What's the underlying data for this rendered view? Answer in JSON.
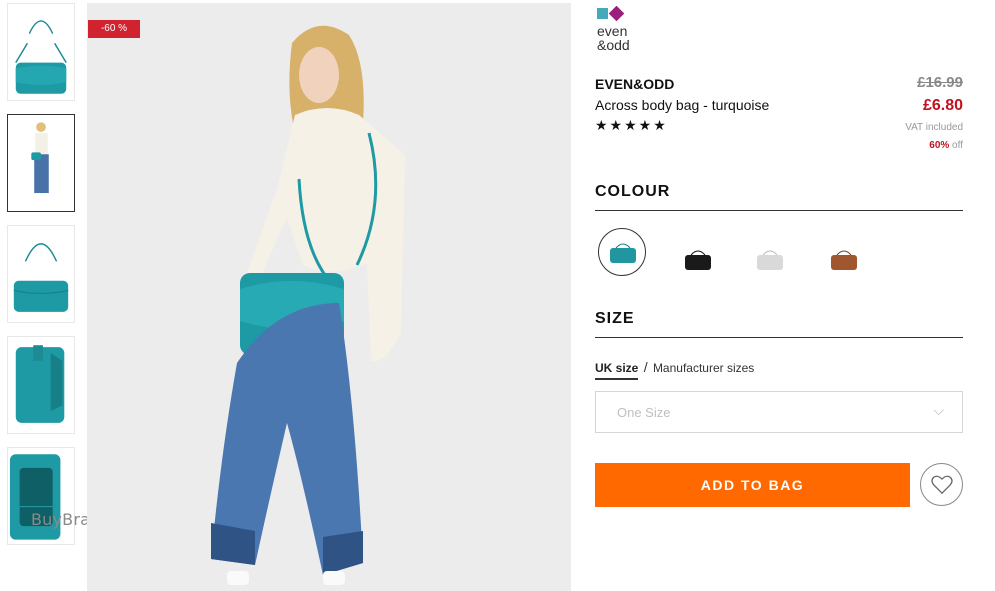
{
  "gallery": {
    "badge": "-60 %",
    "watermark": "BuyBrands",
    "thumbnails": [
      {
        "name": "bag-front"
      },
      {
        "name": "model-full"
      },
      {
        "name": "bag-back"
      },
      {
        "name": "bag-side"
      },
      {
        "name": "bag-inside"
      }
    ]
  },
  "logo": {
    "alt": "even & odd"
  },
  "product": {
    "brand": "EVEN&ODD",
    "title": "Across body bag - turquoise",
    "stars": "★★★★★",
    "old_price": "£16.99",
    "price": "£6.80",
    "vat": "VAT included",
    "discount_pct": "60%",
    "discount_suffix": " off"
  },
  "colour": {
    "heading": "COLOUR",
    "swatches": [
      {
        "name": "turquoise",
        "color": "#2296a0",
        "selected": true
      },
      {
        "name": "black",
        "color": "#1a1a1a",
        "selected": false
      },
      {
        "name": "light-grey",
        "color": "#d9d9d9",
        "selected": false
      },
      {
        "name": "brown",
        "color": "#a0572f",
        "selected": false
      }
    ]
  },
  "size": {
    "heading": "SIZE",
    "tab_uk": "UK size",
    "slash": "/",
    "tab_manufacturer": "Manufacturer sizes",
    "selected_value": "One Size"
  },
  "actions": {
    "add_to_bag": "ADD TO BAG"
  },
  "colors": {
    "accent_orange": "#ff6900",
    "price_red": "#c1121f",
    "badge_red": "#d0232f"
  }
}
